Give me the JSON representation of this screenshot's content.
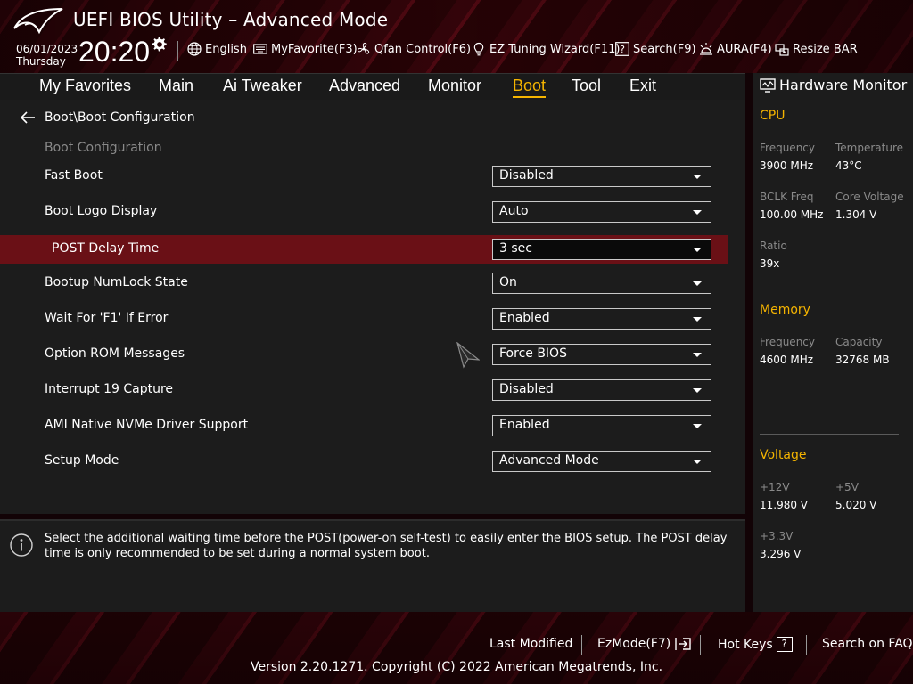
{
  "header": {
    "title": "UEFI BIOS Utility – Advanced Mode",
    "date": "06/01/2023",
    "day": "Thursday",
    "time": "20:20",
    "toolbar": {
      "language": "English",
      "myfavorite": "MyFavorite(F3)",
      "qfan": "Qfan Control(F6)",
      "ez_tuning": "EZ Tuning Wizard(F11)",
      "search": "Search(F9)",
      "aura": "AURA(F4)",
      "resize_bar": "Resize BAR"
    }
  },
  "nav": {
    "tabs": [
      "My Favorites",
      "Main",
      "Ai Tweaker",
      "Advanced",
      "Monitor",
      "Boot",
      "Tool",
      "Exit"
    ],
    "active": "Boot"
  },
  "breadcrumb": "Boot\\Boot Configuration",
  "section_label": "Boot Configuration",
  "settings": [
    {
      "label": "Fast Boot",
      "value": "Disabled"
    },
    {
      "label": "Boot Logo Display",
      "value": "Auto"
    },
    {
      "label": "POST Delay Time",
      "value": "3 sec",
      "selected": true
    },
    {
      "label": "Bootup NumLock State",
      "value": "On"
    },
    {
      "label": "Wait For 'F1' If Error",
      "value": "Enabled"
    },
    {
      "label": "Option ROM Messages",
      "value": "Force BIOS"
    },
    {
      "label": "Interrupt 19 Capture",
      "value": "Disabled"
    },
    {
      "label": "AMI Native NVMe Driver Support",
      "value": "Enabled"
    },
    {
      "label": "Setup Mode",
      "value": "Advanced Mode"
    }
  ],
  "help_text": "Select the additional waiting time before the POST(power-on self-test) to easily enter the BIOS setup. The POST delay time is only recommended to be set during a normal system boot.",
  "hardware_monitor": {
    "title": "Hardware Monitor",
    "cpu": {
      "label": "CPU",
      "frequency_label": "Frequency",
      "frequency": "3900 MHz",
      "temperature_label": "Temperature",
      "temperature": "43°C",
      "bclk_label": "BCLK Freq",
      "bclk": "100.00 MHz",
      "core_voltage_label": "Core Voltage",
      "core_voltage": "1.304 V",
      "ratio_label": "Ratio",
      "ratio": "39x"
    },
    "memory": {
      "label": "Memory",
      "frequency_label": "Frequency",
      "frequency": "4600 MHz",
      "capacity_label": "Capacity",
      "capacity": "32768 MB"
    },
    "voltage": {
      "label": "Voltage",
      "v12_label": "+12V",
      "v12": "11.980 V",
      "v5_label": "+5V",
      "v5": "5.020 V",
      "v33_label": "+3.3V",
      "v33": "3.296 V"
    }
  },
  "footer": {
    "last_modified": "Last Modified",
    "ezmode": "EzMode(F7)",
    "hot_keys": "Hot Keys",
    "hot_keys_key": "?",
    "search_faq": "Search on FAQ",
    "copyright": "Version 2.20.1271. Copyright (C) 2022 American Megatrends, Inc."
  },
  "colors": {
    "accent": "#f5b400",
    "highlight_row": "#6a1016",
    "panel": "#1c1c1c",
    "brand_red": "#5a0a14"
  }
}
